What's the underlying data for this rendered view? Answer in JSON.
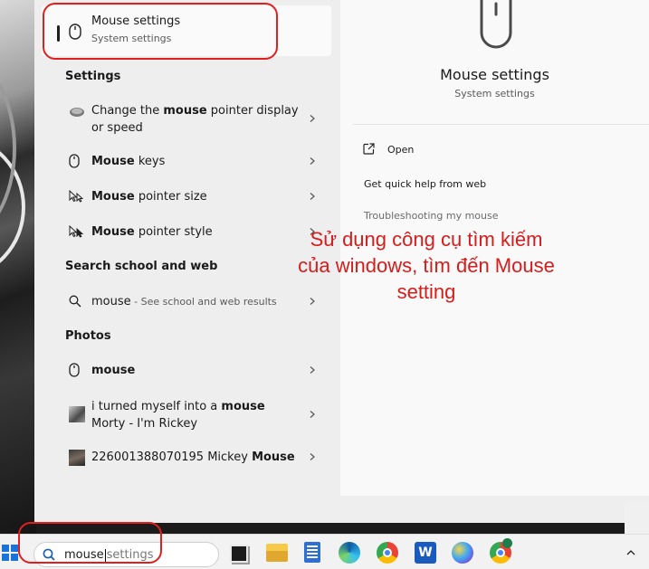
{
  "best_match": {
    "title": "Mouse settings",
    "subtitle": "System settings"
  },
  "sections": {
    "settings": "Settings",
    "search_web": "Search school and web",
    "photos": "Photos"
  },
  "settings_items": [
    {
      "pre": "Change the ",
      "bold": "mouse",
      "post": " pointer display",
      "line2": "or speed"
    },
    {
      "pre": "",
      "bold": "Mouse",
      "post": " keys"
    },
    {
      "pre": "",
      "bold": "Mouse",
      "post": " pointer size"
    },
    {
      "pre": "",
      "bold": "Mouse",
      "post": " pointer style"
    }
  ],
  "web_item": {
    "label": "mouse",
    "sub": " - See school and web results"
  },
  "photo_items": [
    {
      "bold": "mouse"
    },
    {
      "pre": "i turned myself into a ",
      "bold": "mouse",
      "line2": "Morty - I'm Rickey"
    },
    {
      "pre": "226001388070195 Mickey ",
      "bold": "Mouse"
    }
  ],
  "detail": {
    "title": "Mouse settings",
    "subtitle": "System settings",
    "open": "Open",
    "quick_help": "Get quick help from web",
    "troubleshoot": "Troubleshooting my mouse"
  },
  "annotation": "Sử dụng công cụ tìm kiếm của windows, tìm đến Mouse setting",
  "taskbar": {
    "search_typed": "mouse",
    "search_suggest": "settings"
  },
  "colors": {
    "annotation_red": "#d81b1b",
    "highlight_red": "#e02020",
    "panel_bg": "#eeeeee"
  }
}
